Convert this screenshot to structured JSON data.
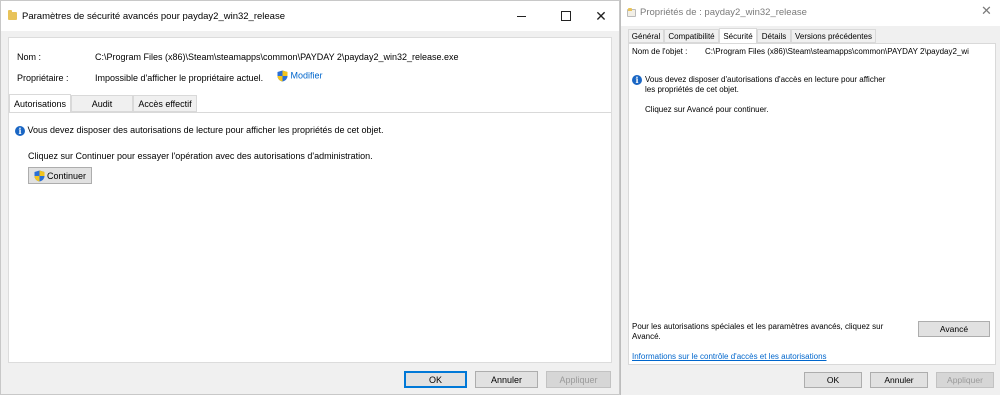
{
  "left_window": {
    "title": "Paramètres de sécurité avancés pour payday2_win32_release",
    "name_label": "Nom :",
    "name_value": "C:\\Program Files (x86)\\Steam\\steamapps\\common\\PAYDAY 2\\payday2_win32_release.exe",
    "owner_label": "Propriétaire :",
    "owner_value": "Impossible d'afficher le propriétaire actuel.",
    "modify_link": "Modifier",
    "tabs": [
      {
        "label": "Autorisations",
        "active": true
      },
      {
        "label": "Audit",
        "active": false
      },
      {
        "label": "Accès effectif",
        "active": false
      }
    ],
    "info_message": "Vous devez disposer des autorisations de lecture pour afficher les propriétés de cet objet.",
    "continue_message": "Cliquez sur Continuer pour essayer l'opération avec des autorisations d'administration.",
    "continue_button": "Continuer",
    "ok_button": "OK",
    "cancel_button": "Annuler",
    "apply_button": "Appliquer"
  },
  "right_window": {
    "title": "Propriétés de : payday2_win32_release",
    "tabs": [
      {
        "label": "Général",
        "active": false
      },
      {
        "label": "Compatibilité",
        "active": false
      },
      {
        "label": "Sécurité",
        "active": true
      },
      {
        "label": "Détails",
        "active": false
      },
      {
        "label": "Versions précédentes",
        "active": false
      }
    ],
    "object_name_label": "Nom de l'objet :",
    "object_name_value": "C:\\Program Files (x86)\\Steam\\steamapps\\common\\PAYDAY 2\\payday2_wi",
    "info_line1": "Vous devez disposer d'autorisations d'accès en lecture pour afficher",
    "info_line2": "les propriétés de cet objet.",
    "advanced_message": "Cliquez sur Avancé pour continuer.",
    "special_line1": "Pour les autorisations spéciales et les paramètres avancés, cliquez sur",
    "special_line2": "Avancé.",
    "advanced_button": "Avancé",
    "help_link": "Informations sur le contrôle d'accès et les autorisations",
    "ok_button": "OK",
    "cancel_button": "Annuler",
    "apply_button": "Appliquer"
  },
  "colors": {
    "link": "#0066cc",
    "info_icon": "#1a66c4",
    "default_button_border": "#0078d7"
  }
}
